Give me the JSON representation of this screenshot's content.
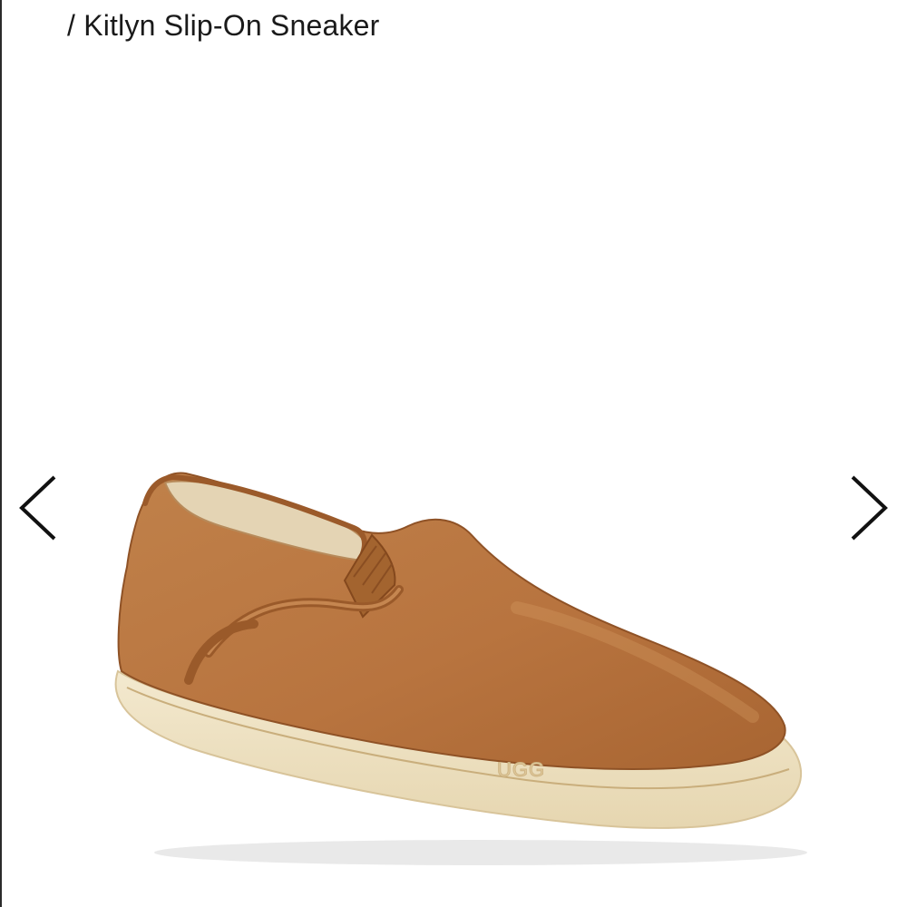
{
  "breadcrumb": {
    "separator": "/",
    "current": "Kitlyn Slip-On Sneaker"
  },
  "gallery": {
    "prev_icon": "chevron-left-icon",
    "next_icon": "chevron-right-icon",
    "image": {
      "brand_mark": "UGG",
      "upper_color": "#b8743f",
      "sole_color": "#efe3c4",
      "lining_color": "#e4d4b4"
    }
  }
}
